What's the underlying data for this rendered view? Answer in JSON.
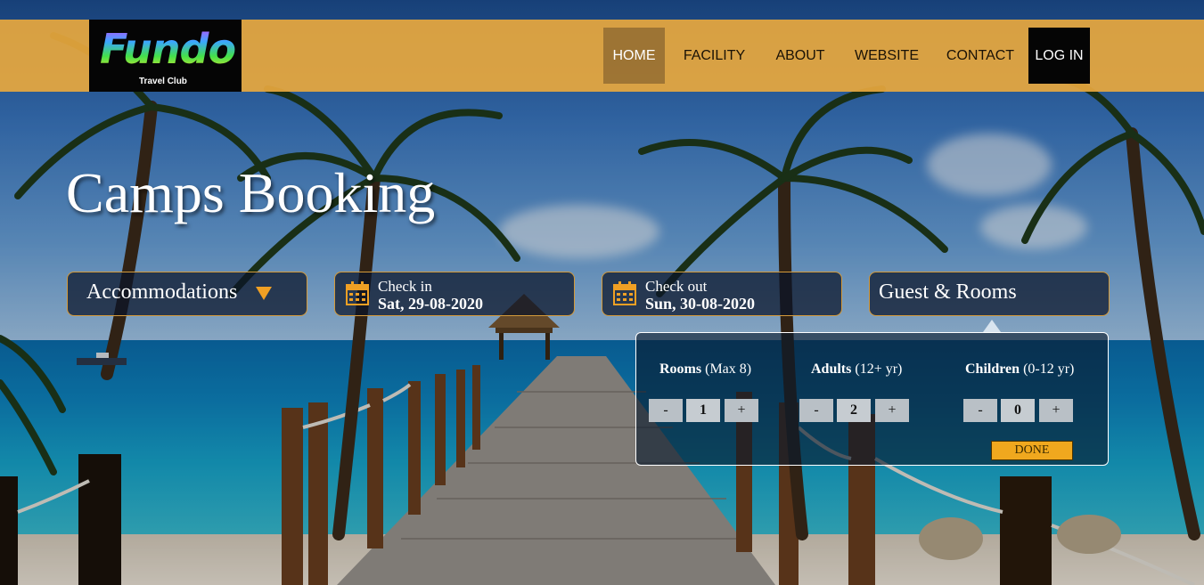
{
  "brand": {
    "name": "Fundo",
    "tagline": "Travel Club"
  },
  "nav": {
    "items": [
      {
        "label": "HOME"
      },
      {
        "label": "FACILITY"
      },
      {
        "label": "ABOUT"
      },
      {
        "label": "WEBSITE"
      },
      {
        "label": "CONTACT"
      },
      {
        "label": "LOG IN"
      }
    ],
    "active": "HOME"
  },
  "hero": {
    "title": "Camps Booking"
  },
  "search": {
    "accommodations": {
      "label": "Accommodations",
      "icon": "caret-down-icon"
    },
    "check_in": {
      "label": "Check in",
      "date": "Sat, 29-08-2020",
      "icon": "calendar-icon"
    },
    "check_out": {
      "label": "Check out",
      "date": "Sun, 30-08-2020",
      "icon": "calendar-icon"
    },
    "guests": {
      "label": "Guest & Rooms"
    }
  },
  "guest_panel": {
    "rooms": {
      "title": "Rooms",
      "note": "(Max 8)",
      "value": "1"
    },
    "adults": {
      "title": "Adults",
      "note": "(12+ yr)",
      "value": "2"
    },
    "children": {
      "title": "Children",
      "note": "(0-12 yr)",
      "value": "0"
    },
    "minus": "-",
    "plus": "+",
    "done": "DONE"
  },
  "colors": {
    "accent": "#e8a83e",
    "dark": "#050505",
    "button": "#f0a81e"
  }
}
